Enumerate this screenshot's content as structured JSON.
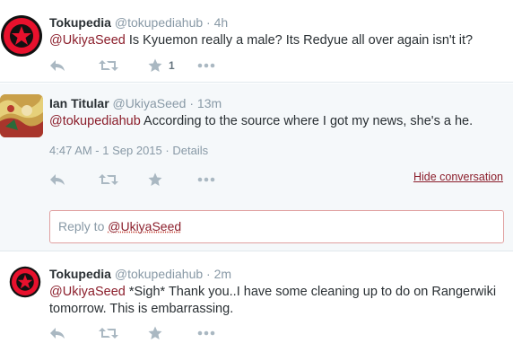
{
  "tweets": [
    {
      "fullname": "Tokupedia",
      "username": "@tokupediahub",
      "separator": "·",
      "time": "4h",
      "mention": "@UkiyaSeed",
      "text": " Is Kyuemon really a male? Its Redyue all over again isn't it?",
      "favorite_count": "1"
    },
    {
      "fullname": "Ian Titular",
      "username": "@UkiyaSeed",
      "separator": "·",
      "time": "13m",
      "mention": "@tokupediahub",
      "text": " According to the source where I got my news, she's a he.",
      "timestamp": "4:47 AM - 1 Sep 2015",
      "details_sep": "·",
      "details_label": "Details",
      "hide_conversation": "Hide conversation"
    },
    {
      "fullname": "Tokupedia",
      "username": "@tokupediahub",
      "separator": "·",
      "time": "2m",
      "mention": "@UkiyaSeed",
      "text": " *Sigh* Thank you..I have some cleaning up to do on Rangerwiki tomorrow. This is embarrassing."
    }
  ],
  "reply": {
    "prefix": "Reply to ",
    "mention": "@UkiyaSeed"
  },
  "icons": [
    "reply-icon",
    "retweet-icon",
    "favorite-icon",
    "more-icon",
    "tokupedia-logo",
    "user-avatar"
  ],
  "colors": {
    "link": "#8b1e2b",
    "muted": "#8899a6",
    "expanded_bg": "#f5f8fa",
    "logo_red": "#e8112d"
  }
}
